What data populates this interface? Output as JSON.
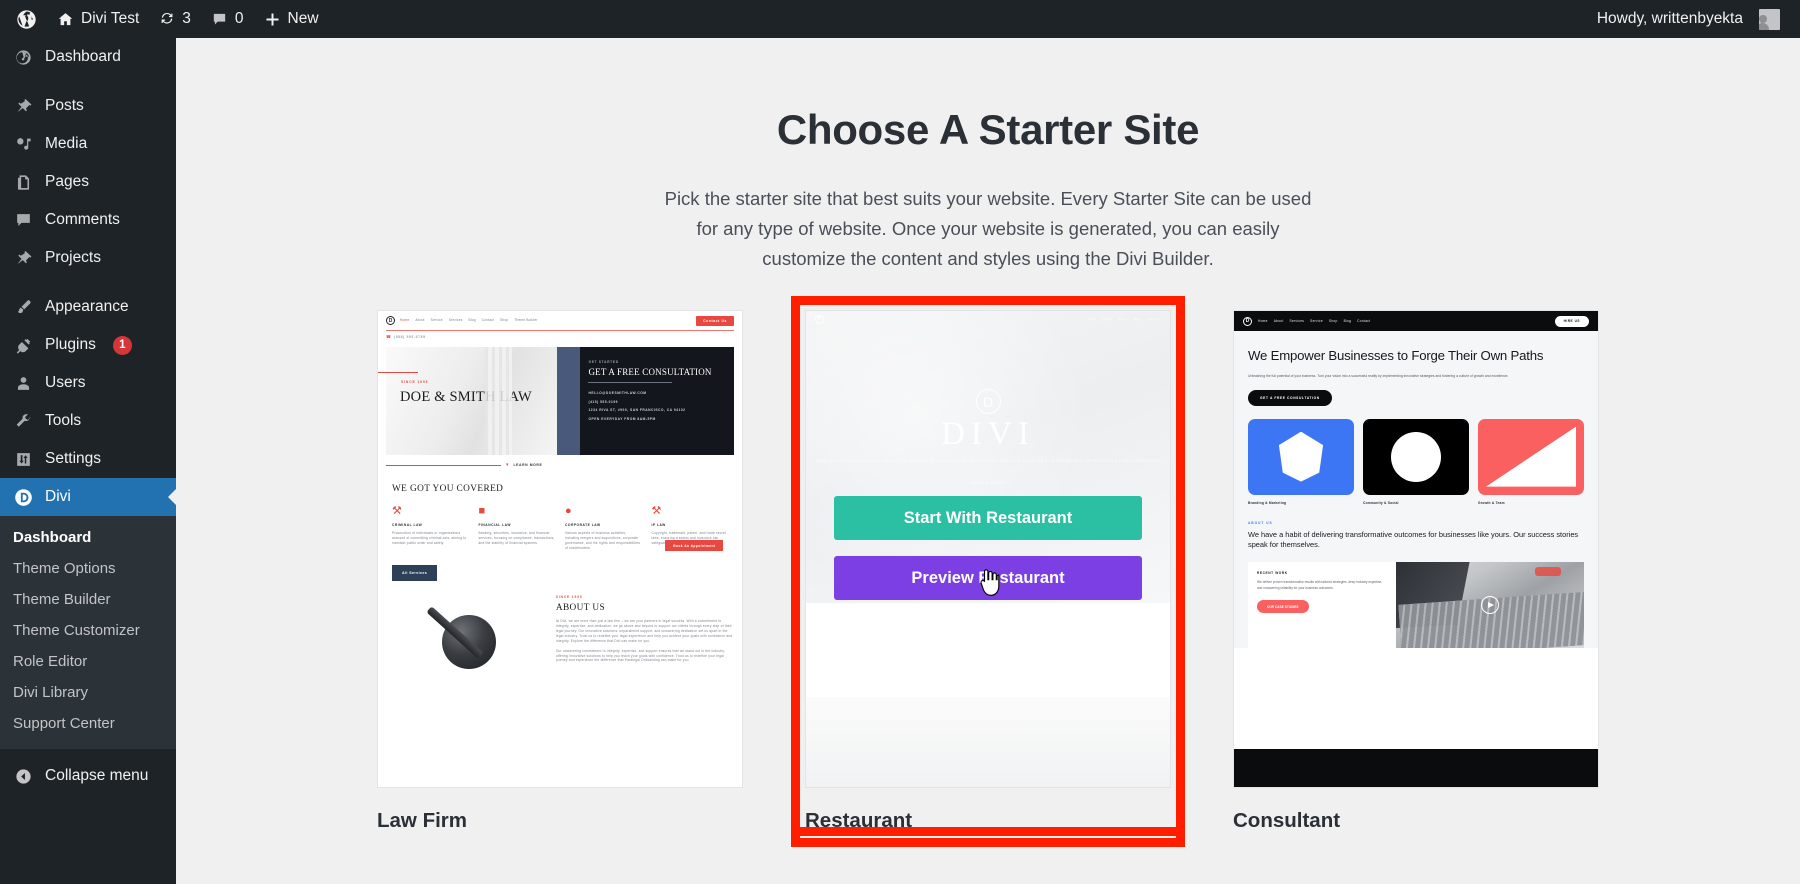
{
  "adminbar": {
    "wp_logo": "wordpress-logo",
    "site_name": "Divi Test",
    "updates_count": "3",
    "comments_count": "0",
    "new_label": "New",
    "howdy": "Howdy, writtenbyekta"
  },
  "sidebar": {
    "items": [
      {
        "label": "Dashboard",
        "icon": "dashboard-icon",
        "badge": ""
      },
      {
        "label": "Posts",
        "icon": "pin-icon",
        "badge": ""
      },
      {
        "label": "Media",
        "icon": "media-icon",
        "badge": ""
      },
      {
        "label": "Pages",
        "icon": "pages-icon",
        "badge": ""
      },
      {
        "label": "Comments",
        "icon": "comments-icon",
        "badge": ""
      },
      {
        "label": "Projects",
        "icon": "pin-icon",
        "badge": ""
      },
      {
        "label": "Appearance",
        "icon": "brush-icon",
        "badge": ""
      },
      {
        "label": "Plugins",
        "icon": "plug-icon",
        "badge": "1"
      },
      {
        "label": "Users",
        "icon": "user-icon",
        "badge": ""
      },
      {
        "label": "Tools",
        "icon": "wrench-icon",
        "badge": ""
      },
      {
        "label": "Settings",
        "icon": "settings-icon",
        "badge": ""
      },
      {
        "label": "Divi",
        "icon": "divi-icon",
        "badge": ""
      }
    ],
    "submenu": [
      "Dashboard",
      "Theme Options",
      "Theme Builder",
      "Theme Customizer",
      "Role Editor",
      "Divi Library",
      "Support Center"
    ],
    "collapse_label": "Collapse menu",
    "active_color": "#2271b1",
    "badge_color": "#d63638"
  },
  "main": {
    "title": "Choose A Starter Site",
    "description": "Pick the starter site that best suits your website. Every Starter Site can be used for any type of website. Once your website is generated, you can easily customize the content and styles using the Divi Builder."
  },
  "cards": [
    {
      "label": "Law Firm",
      "selected": false
    },
    {
      "label": "Restaurant",
      "selected": true
    },
    {
      "label": "Consultant",
      "selected": false
    }
  ],
  "selected_card": {
    "start_button": "Start With Restaurant",
    "preview_button": "Preview Restaurant",
    "start_color": "#2bbfa3",
    "preview_color": "#7b3fe4",
    "highlight_color": "#ff1e00"
  },
  "lawfirm_preview": {
    "nav": [
      "Home",
      "About",
      "Service",
      "Services",
      "Blog",
      "Contact",
      "Shop",
      "Theme Builder"
    ],
    "nav_cta": "Contact Us",
    "phone": "(888) 555-6789",
    "since": "SINCE 1995",
    "hero_title": "DOE & SMITH LAW",
    "panel_eyebrow": "GET STARTED",
    "panel_title": "GET A FREE CONSULTATION",
    "panel_rows": [
      "HELLO@DOESMITHLAW.COM",
      "(415) 555-0199",
      "1234 RIVA ST, #900, SAN FRANCISCO, CA 94102",
      "OPEN EVERYDAY FROM 8AM-5PM"
    ],
    "panel_button": "Book An Appointment",
    "learn_more": "LEARN MORE",
    "section_title": "WE GOT YOU COVERED",
    "columns": [
      {
        "icon": "gavel-icon",
        "title": "CRIMINAL LAW",
        "text": "Prosecution of individuals or organizations accused of committing criminal acts, aiming to maintain public order and safety."
      },
      {
        "icon": "coins-icon",
        "title": "FINANCIAL LAW",
        "text": "Banking, securities, insurance, and financial services, focusing on compliance, transactions, and the stability of financial systems."
      },
      {
        "icon": "corporate-icon",
        "title": "CORPORATE LAW",
        "text": "Various aspects of business activities, including mergers and acquisitions, corporate governance, and the rights and responsibilities of shareholders."
      },
      {
        "icon": "ip-icon",
        "title": "IP LAW",
        "text": "Copyright, trademark, patent, and trade secret laws, ensuring creators and inventors can safeguard their innovations and works."
      }
    ],
    "all_services": "All Services",
    "about_eyebrow": "SINCE 1995",
    "about_title": "ABOUT US",
    "about_text1": "At Divi, we are more than just a law firm – we are your partners in legal success. With a commitment to integrity, expertise, and dedication, we go above and beyond to support our clients through every step of their legal journey. Our innovative solutions, unparalleled support, and unwavering dedication set us apart in the legal industry. Trust us to redefine your legal experience and help you achieve your goals with confidence and integrity. Explore the difference that Divi can make for you.",
    "about_text2": "Our unwavering commitment to integrity, expertise, and support ensures that we stand out in the industry, offering innovative solutions to help you reach your goals with confidence. Trust us to redefine your legal journey and experience the difference that Paralegal Onboarding can make for you."
  },
  "restaurant_preview": {
    "logo_mark": "divi-circle-icon",
    "brand": "DIVI",
    "tagline": "INDULGE YOUR SENSES IN A VARIETY OF EXQUISITE FLAVORS AND METICULOUS SERVICE, CRAFTED FOR THOSE WHO APPRECIATE A FINE EXPERIENCE",
    "hero_button": "BOOK A TABLE",
    "nav": [
      "Home",
      "About",
      "Menu",
      "Blog",
      "Contact"
    ]
  },
  "consultant_preview": {
    "nav": [
      "Home",
      "About",
      "Services",
      "Service",
      "Shop",
      "Blog",
      "Contact"
    ],
    "nav_cta": "HIRE US",
    "headline": "We Empower Businesses to Forge Their Own Paths",
    "subtext": "Unleashing the full potential of your business. Turn your vision into a successful reality by implementing innovative strategies and fostering a culture of growth and excellence.",
    "cta": "GET A FREE CONSULTATION",
    "tiles": [
      {
        "shape": "hexagon",
        "color": "#3d76f5",
        "label": "Branding & Marketing"
      },
      {
        "shape": "circle",
        "color": "#000000",
        "label": "Community & Social"
      },
      {
        "shape": "triangle",
        "color": "#f9605f",
        "label": "Growth & Team"
      }
    ],
    "about_eyebrow": "ABOUT US",
    "about_title": "We have a habit of delivering transformative outcomes for businesses like yours. Our success stories speak for themselves.",
    "recent_title": "RECENT WORK",
    "recent_text": "We deliver proven transformative results with tailored strategies, deep industry expertise, and unwavering reliability for your business outcomes.",
    "recent_button": "OUR CASE STUDIES",
    "play_icon": "play-icon"
  },
  "cursor": {
    "type": "pointer-hand-cursor"
  }
}
